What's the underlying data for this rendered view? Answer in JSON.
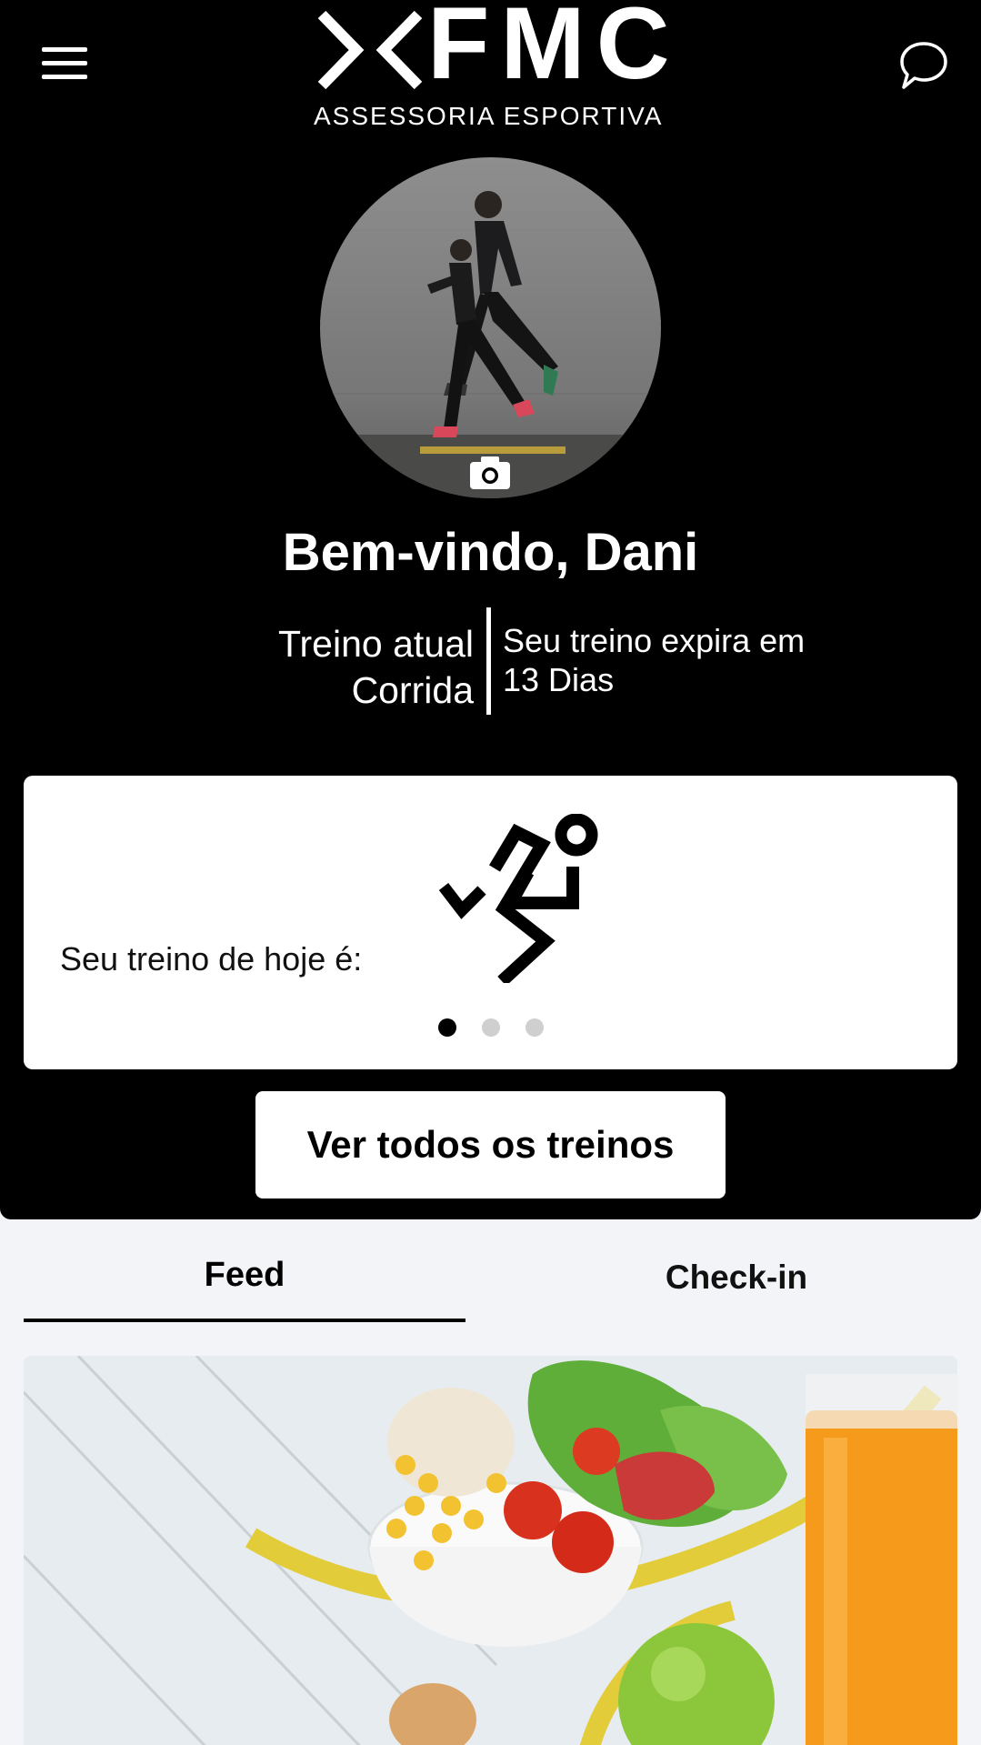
{
  "header": {
    "logo_text": "FMC",
    "logo_subtitle": "ASSESSORIA ESPORTIVA",
    "menu_icon": "hamburger-menu-icon",
    "chat_icon": "chat-bubble-icon"
  },
  "profile": {
    "welcome": "Bem-vindo, Dani",
    "current_label": "Treino atual",
    "current_value": "Corrida",
    "expires_label": "Seu treino expira em",
    "expires_value": "13 Dias",
    "camera_icon": "camera-icon"
  },
  "today": {
    "label": "Seu treino de hoje é:",
    "icon": "running-person-icon",
    "active_slide": 1,
    "slide_count": 3
  },
  "actions": {
    "view_all": "Ver todos os treinos"
  },
  "tabs": [
    {
      "label": "Feed",
      "active": true
    },
    {
      "label": "Check-in",
      "active": false
    }
  ],
  "colors": {
    "header_bg": "#000000",
    "page_bg": "#f2f4f8",
    "card_bg": "#ffffff",
    "dot_inactive": "#cfcfcf"
  }
}
